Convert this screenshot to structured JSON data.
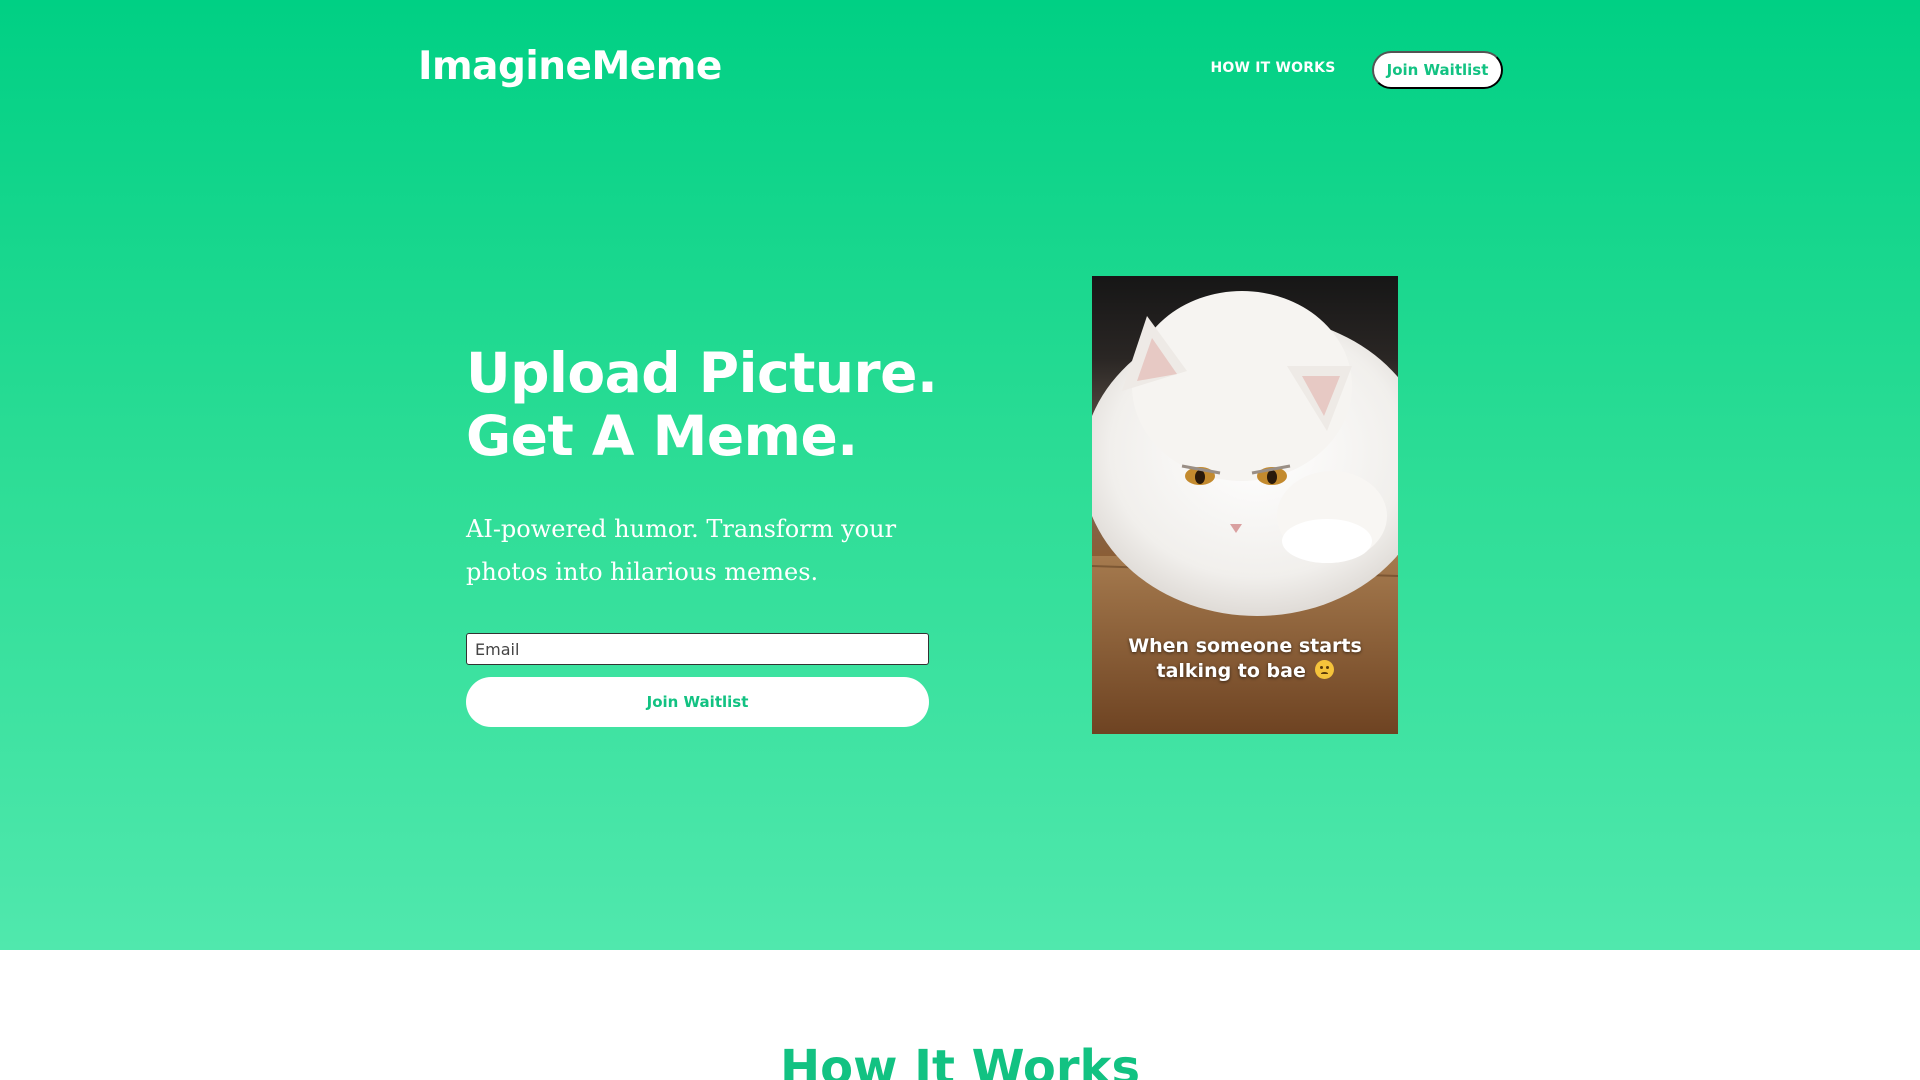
{
  "header": {
    "logo": "ImagineMeme",
    "nav_link": "HOW IT WORKS",
    "cta_label": "Join Waitlist"
  },
  "hero": {
    "headline_line1": "Upload Picture.",
    "headline_line2": "Get A Meme.",
    "subtext": "AI-powered humor. Transform your photos into hilarious memes.",
    "email_placeholder": "Email",
    "button_label": "Join Waitlist"
  },
  "meme": {
    "caption": "When someone starts talking to bae",
    "emoji_icon": "angry-face-icon"
  },
  "how_it_works": {
    "title": "How It Works"
  },
  "colors": {
    "brand_green": "#00d084",
    "accent_text": "#12c282",
    "white": "#ffffff"
  }
}
